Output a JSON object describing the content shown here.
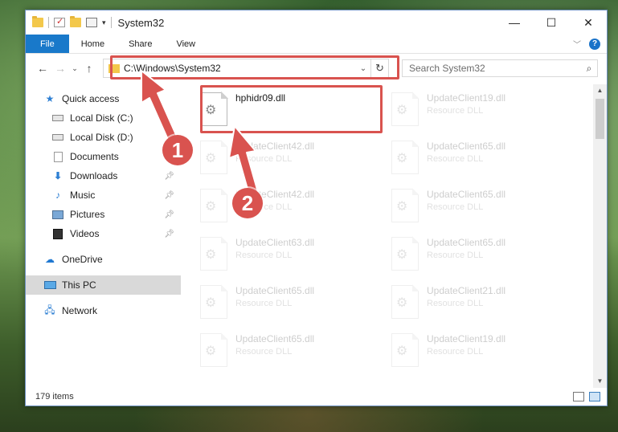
{
  "window": {
    "title": "System32",
    "controls": {
      "minimize": "—",
      "maximize": "☐",
      "close": "✕"
    }
  },
  "ribbon": {
    "tabs": [
      "File",
      "Home",
      "Share",
      "View"
    ],
    "help": "?"
  },
  "address": {
    "path": "C:\\Windows\\System32",
    "search_placeholder": "Search System32"
  },
  "nav": {
    "quick_access": "Quick access",
    "items": [
      {
        "label": "Local Disk (C:)",
        "icon": "drive-icon",
        "pinned": false
      },
      {
        "label": "Local Disk (D:)",
        "icon": "drive-icon",
        "pinned": false
      },
      {
        "label": "Documents",
        "icon": "documents-icon",
        "pinned": false
      },
      {
        "label": "Downloads",
        "icon": "downloads-icon",
        "pinned": true
      },
      {
        "label": "Music",
        "icon": "music-icon",
        "pinned": true
      },
      {
        "label": "Pictures",
        "icon": "pictures-icon",
        "pinned": true
      },
      {
        "label": "Videos",
        "icon": "videos-icon",
        "pinned": true
      }
    ],
    "onedrive": "OneDrive",
    "this_pc": "This PC",
    "network": "Network"
  },
  "files": {
    "selected": {
      "name": "hphidr09.dll",
      "type": ""
    },
    "column1": [
      {
        "name": "UpdateClient42.dll",
        "type": "Resource DLL"
      },
      {
        "name": "UpdateClient42.dll",
        "type": "Resource DLL"
      },
      {
        "name": "UpdateClient63.dll",
        "type": "Resource DLL"
      },
      {
        "name": "UpdateClient65.dll",
        "type": "Resource DLL"
      },
      {
        "name": "UpdateClient65.dll",
        "type": "Resource DLL"
      }
    ],
    "column2": [
      {
        "name": "UpdateClient19.dll",
        "type": "Resource DLL"
      },
      {
        "name": "UpdateClient65.dll",
        "type": "Resource DLL"
      },
      {
        "name": "UpdateClient65.dll",
        "type": "Resource DLL"
      },
      {
        "name": "UpdateClient65.dll",
        "type": "Resource DLL"
      },
      {
        "name": "UpdateClient21.dll",
        "type": "Resource DLL"
      },
      {
        "name": "UpdateClient19.dll",
        "type": "Resource DLL"
      }
    ]
  },
  "status": {
    "items": "179 items"
  },
  "annotations": {
    "step1": "1",
    "step2": "2",
    "color": "#d9534f"
  }
}
